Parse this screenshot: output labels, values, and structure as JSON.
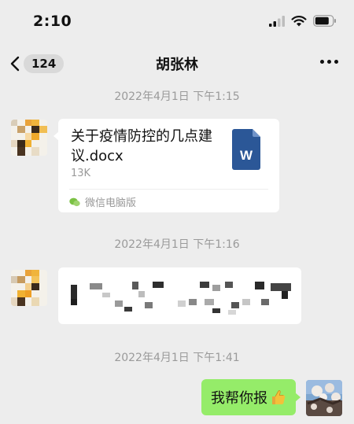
{
  "status_bar": {
    "time": "2:10"
  },
  "nav": {
    "back_badge": "124",
    "title": "胡张林"
  },
  "messages": [
    {
      "timestamp": "2022年4月1日 下午1:15"
    },
    {
      "file": {
        "name": "关于疫情防控的几点建议.docx",
        "size": "13K",
        "source": "微信电脑版",
        "icon": "word-document-icon"
      }
    },
    {
      "timestamp": "2022年4月1日 下午1:16"
    },
    {
      "redacted_message": "pixelated"
    },
    {
      "timestamp": "2022年4月1日 下午1:41"
    },
    {
      "outgoing_text": "我帮你报",
      "emoji": "thumbs-up"
    }
  ],
  "colors": {
    "background": "#ededed",
    "outgoing_bubble": "#95ec69",
    "word_blue": "#2b5797"
  }
}
